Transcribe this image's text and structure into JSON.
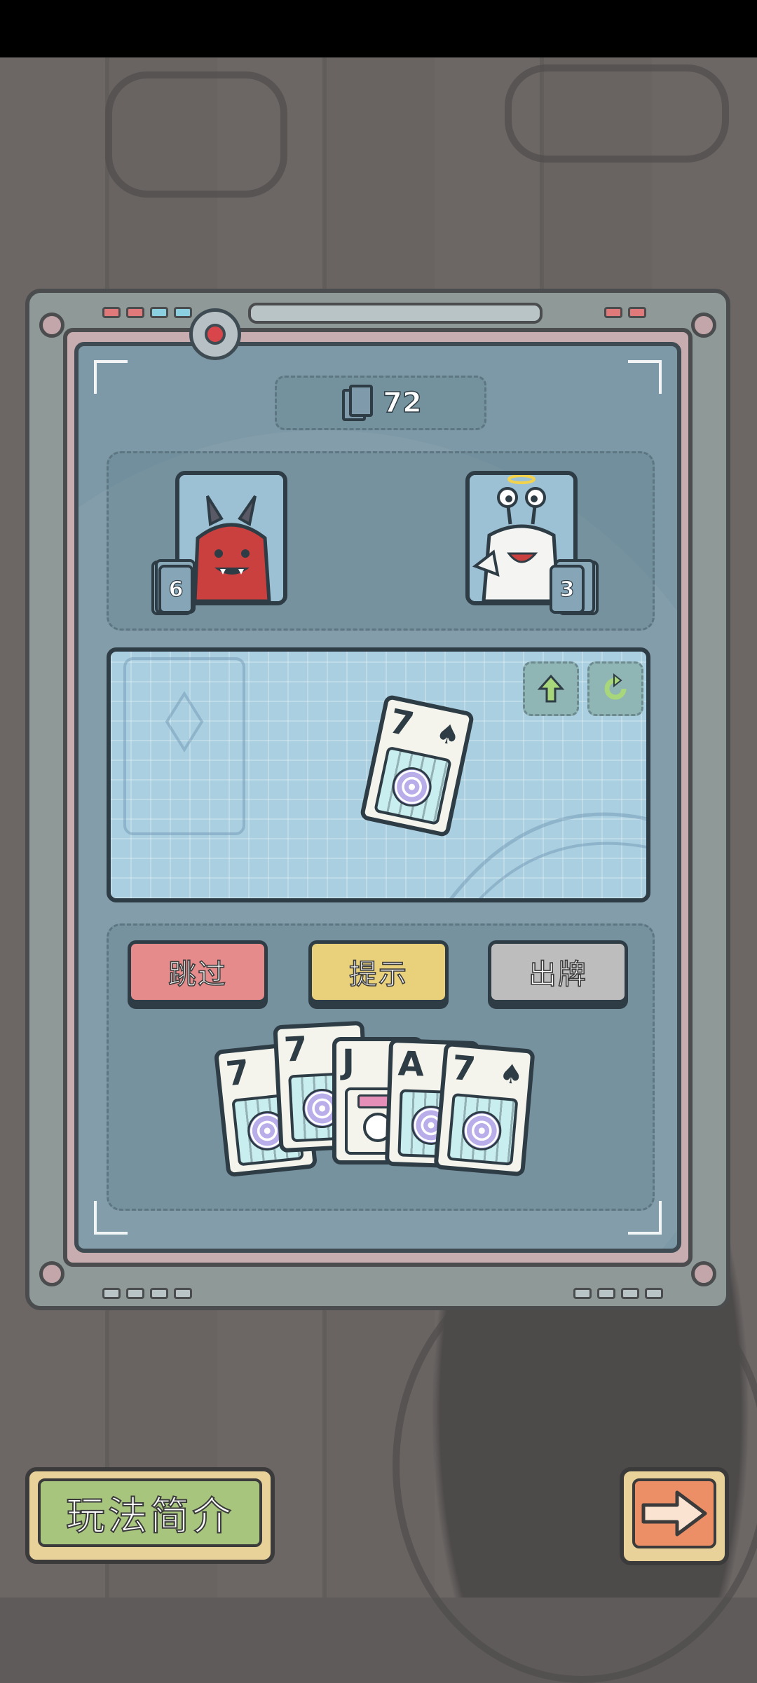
{
  "deck": {
    "icon": "card-deck-icon",
    "count": "72"
  },
  "players": [
    {
      "id": "red-demon",
      "cards_left": "6"
    },
    {
      "id": "white-snail",
      "cards_left": "3"
    }
  ],
  "table": {
    "played_card": {
      "rank": "7",
      "suit": "♠"
    },
    "buttons": [
      {
        "icon": "arrow-up-icon"
      },
      {
        "icon": "refresh-icon"
      }
    ]
  },
  "actions": {
    "pass": "跳过",
    "hint": "提示",
    "play": "出牌"
  },
  "hand": [
    {
      "rank": "7",
      "suit": ""
    },
    {
      "rank": "7",
      "suit": ""
    },
    {
      "rank": "J",
      "suit": ""
    },
    {
      "rank": "A",
      "suit": ""
    },
    {
      "rank": "7",
      "suit": "♠"
    }
  ],
  "footer": {
    "guide_label": "玩法简介",
    "next_icon": "arrow-right-icon"
  },
  "colors": {
    "pass": "#e58b8b",
    "hint": "#e9d07a",
    "play": "#bdbdbd",
    "screen": "#7d98a6",
    "accent_red": "#d8454a"
  }
}
